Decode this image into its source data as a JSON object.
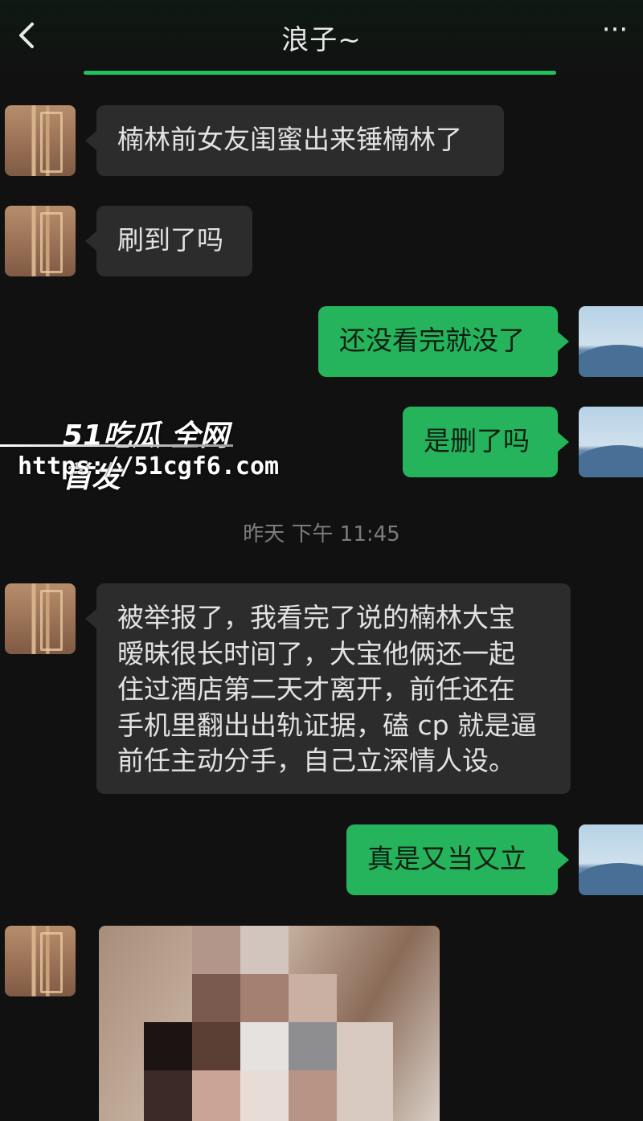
{
  "header": {
    "title": "浪子~",
    "back_icon": "chevron-left-icon",
    "more_label": "···"
  },
  "messages": [
    {
      "side": "in",
      "text": "楠林前女友闺蜜出来锤楠林了"
    },
    {
      "side": "in",
      "text": "刷到了吗"
    },
    {
      "side": "out",
      "text": "还没看完就没了"
    },
    {
      "side": "out",
      "text": "是删了吗"
    },
    {
      "side": "in",
      "text": "被举报了，我看完了说的楠林大宝\n暧昧很长时间了，大宝他俩还一起\n住过酒店第二天才离开，前任还在\n手机里翻出出轨证据，磕 cp 就是逼\n前任主动分手，自己立深情人设。"
    },
    {
      "side": "out",
      "text": "真是又当又立"
    }
  ],
  "timestamp": "昨天 下午 11:45",
  "watermark": {
    "brand": "51吃瓜 全网首发",
    "url": "https://51cgf6.com"
  },
  "colors": {
    "background": "#111111",
    "incoming_bubble": "#2c2c2c",
    "outgoing_bubble": "#25b35c",
    "accent": "#21c25d"
  }
}
